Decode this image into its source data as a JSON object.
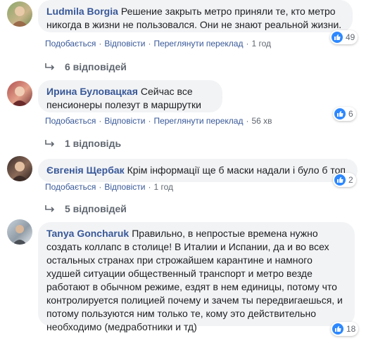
{
  "comments": [
    {
      "author": "Ludmila Borgia",
      "text": "Решение закрыть метро приняли те, кто метро никогда в жизни не пользовался. Они не знают реальной жизни.",
      "reactions": "49",
      "like": "Подобається",
      "reply": "Відповісти",
      "translate": "Переглянути переклад",
      "time": "1 год",
      "replies": "6 відповідей"
    },
    {
      "author": "Ирина Буловацкая",
      "text": "Сейчас все пенсионеры полезут в маршрутки",
      "reactions": "6",
      "like": "Подобається",
      "reply": "Відповісти",
      "translate": "Переглянути переклад",
      "time": "56 хв",
      "replies": "1 відповідь"
    },
    {
      "author": "Євгенія Щербак",
      "text": "Крім інформації ще б маски надали і було б топ",
      "reactions": "2",
      "like": "Подобається",
      "reply": "Відповісти",
      "time": "1 год",
      "replies": "5 відповідей"
    },
    {
      "author": "Tanya Goncharuk",
      "text": "Правильно, в непростые времена нужно создать коллапс в столице! В Италии и Испании, да и во всех остальных странах при строжайшем карантине и намного худшей ситуации общественный транспорт и метро везде работают в обычном режиме, ездят в нем единицы, потому что контролируется полицией почему и зачем ты передвигаешься, и потому пользуются ним только те, кому это действительно необходимо (медработники и тд)",
      "reactions": "18"
    }
  ],
  "colors": {
    "author": "#385898",
    "bubble": "#f2f3f5",
    "like_badge": "#2d88ff",
    "meta": "#606770"
  }
}
